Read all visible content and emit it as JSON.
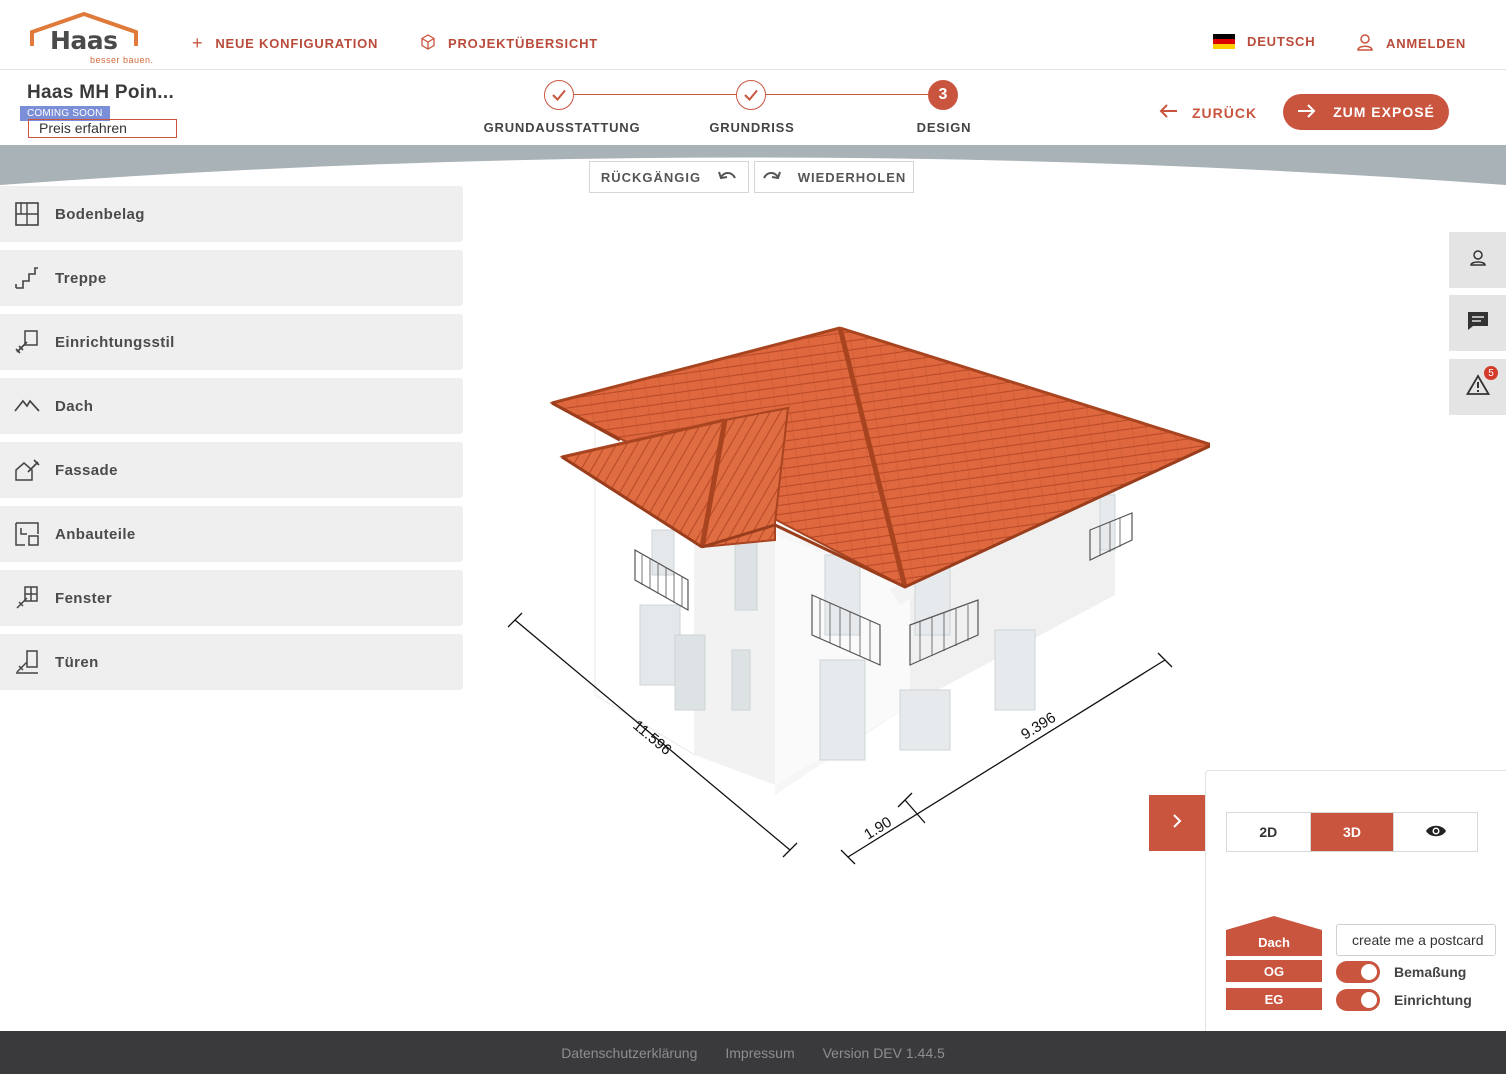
{
  "header": {
    "logo_text": "Haas",
    "logo_tagline": "besser bauen.",
    "nav": [
      {
        "label": "NEUE KONFIGURATION",
        "icon": "plus-icon"
      },
      {
        "label": "PROJEKTÜBERSICHT",
        "icon": "cube-icon"
      }
    ],
    "language": "DEUTSCH",
    "login": "ANMELDEN"
  },
  "project": {
    "title": "Haas MH Poin...",
    "badge": "COMING SOON",
    "price_link": "Preis erfahren"
  },
  "steps": [
    {
      "label": "GRUNDAUSSTATTUNG",
      "state": "done"
    },
    {
      "label": "GRUNDRISS",
      "state": "done"
    },
    {
      "label": "DESIGN",
      "state": "active",
      "number": "3"
    }
  ],
  "actions": {
    "back": "ZURÜCK",
    "expose": "ZUM EXPOSÉ",
    "undo": "RÜCKGÄNGIG",
    "redo": "WIEDERHOLEN"
  },
  "sidebar": {
    "items": [
      {
        "label": "Bodenbelag",
        "icon": "floor-icon"
      },
      {
        "label": "Treppe",
        "icon": "stairs-icon"
      },
      {
        "label": "Einrichtungsstil",
        "icon": "brush-icon"
      },
      {
        "label": "Dach",
        "icon": "roof-icon"
      },
      {
        "label": "Fassade",
        "icon": "facade-icon"
      },
      {
        "label": "Anbauteile",
        "icon": "addon-icon"
      },
      {
        "label": "Fenster",
        "icon": "window-icon"
      },
      {
        "label": "Türen",
        "icon": "door-icon"
      }
    ]
  },
  "floating": {
    "alert_count": "5"
  },
  "dimensions": {
    "left": "11.596",
    "right": "9.396",
    "front": "1.90"
  },
  "view_panel": {
    "modes": [
      "2D",
      "3D"
    ],
    "active_mode": "3D",
    "floors": [
      "Dach",
      "OG",
      "EG"
    ],
    "postcard_value": "create me a postcard",
    "toggles": [
      {
        "label": "Bemaßung",
        "on": true
      },
      {
        "label": "Einrichtung",
        "on": true
      }
    ]
  },
  "footer": {
    "links": [
      "Datenschutzerklärung",
      "Impressum",
      "Version DEV 1.44.5"
    ]
  },
  "colors": {
    "accent": "#c9553f",
    "roof": "#e0683f",
    "footer_bg": "#3a3a3c"
  }
}
